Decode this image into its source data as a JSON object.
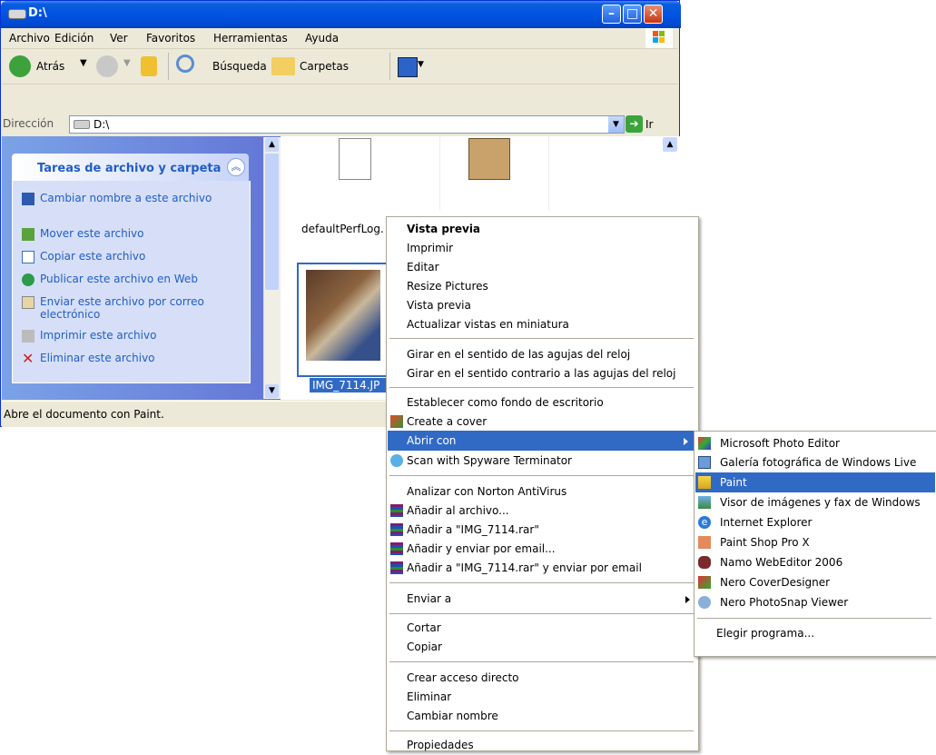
{
  "window": {
    "title": "D:\\"
  },
  "menubar": {
    "items": [
      "Archivo",
      "Edición",
      "Ver",
      "Favoritos",
      "Herramientas",
      "Ayuda"
    ]
  },
  "toolbar": {
    "back": "Atrás",
    "search": "Búsqueda",
    "folders": "Carpetas"
  },
  "address": {
    "label": "Dirección",
    "value": "D:\\",
    "go": "Ir"
  },
  "tasks": {
    "title": "Tareas de archivo y carpeta",
    "items": [
      "Cambiar nombre a este archivo",
      "Mover este archivo",
      "Copiar este archivo",
      "Publicar este archivo en Web",
      "Enviar este archivo por correo electrónico",
      "Imprimir este archivo",
      "Eliminar este archivo"
    ]
  },
  "files": [
    {
      "name": "defaultPerfLog."
    },
    {
      "name": "IMG_7114.JP"
    }
  ],
  "status": {
    "text": "Abre el documento con Paint."
  },
  "context_menu": {
    "items": [
      "Vista previa",
      "Imprimir",
      "Editar",
      "Resize Pictures",
      "Vista previa",
      "Actualizar vistas en miniatura",
      "Girar en el sentido de las agujas del reloj",
      "Girar en el sentido contrario a las agujas del reloj",
      "Establecer como fondo de escritorio",
      "Create a cover",
      "Abrir con",
      "Scan with Spyware Terminator",
      "Analizar con Norton AntiVirus",
      "Añadir al archivo...",
      "Añadir a \"IMG_7114.rar\"",
      "Añadir y enviar por email...",
      "Añadir a \"IMG_7114.rar\" y enviar por email",
      "Enviar a",
      "Cortar",
      "Copiar",
      "Crear acceso directo",
      "Eliminar",
      "Cambiar nombre",
      "Propiedades"
    ]
  },
  "open_with_menu": {
    "items": [
      "Microsoft Photo Editor",
      "Galería fotográfica de Windows Live",
      "Paint",
      "Visor de imágenes y fax de Windows",
      "Internet Explorer",
      "Paint Shop Pro X",
      "Namo WebEditor 2006",
      "Nero CoverDesigner",
      "Nero PhotoSnap Viewer",
      "Elegir programa..."
    ],
    "highlighted": "Paint"
  },
  "colors": {
    "titlebar": "#0054e3",
    "highlight": "#316ac5",
    "taskpane": "#6375d6"
  }
}
